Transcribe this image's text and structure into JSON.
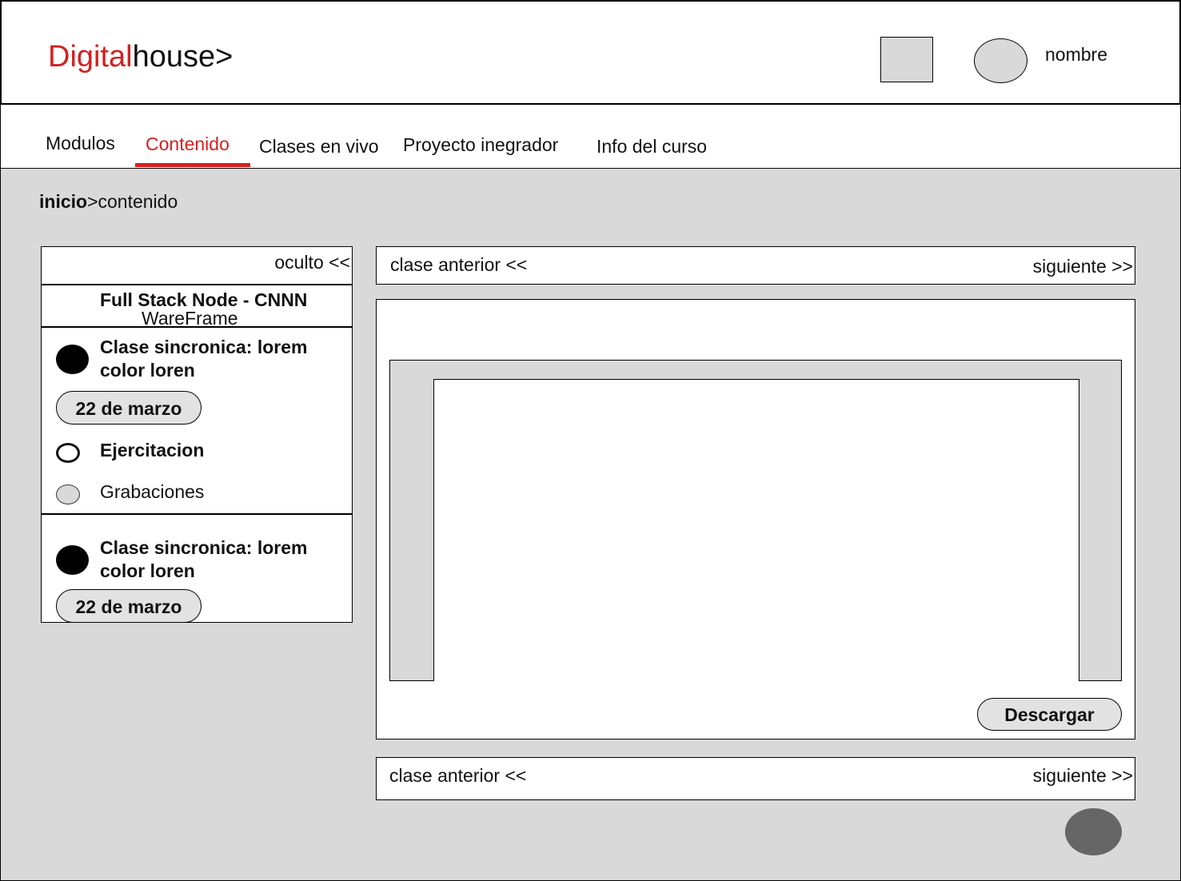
{
  "header": {
    "logo_part1": "Digital",
    "logo_part2": "house>",
    "user_name": "nombre"
  },
  "nav": {
    "tabs": [
      {
        "label": "Modulos"
      },
      {
        "label": "Contenido",
        "active": true
      },
      {
        "label": "Clases en vivo"
      },
      {
        "label": "Proyecto inegrador"
      },
      {
        "label": "Info del curso"
      }
    ]
  },
  "breadcrumb": {
    "root": "inicio",
    "separator": ">",
    "current": "contenido"
  },
  "sidebar": {
    "toggle_label": "oculto <<",
    "course_title": "Full Stack Node - CNNN",
    "course_subtitle": "WareFrame",
    "classes": [
      {
        "title_line1": "Clase sincronica: lorem",
        "title_line2": "color loren",
        "date": "22 de marzo",
        "items": [
          {
            "label": "Ejercitacion",
            "style": "ring"
          },
          {
            "label": "Grabaciones",
            "style": "grey"
          }
        ]
      },
      {
        "title_line1": "Clase sincronica: lorem",
        "title_line2": "color loren",
        "date": "22 de marzo"
      }
    ]
  },
  "pager_top": {
    "prev_label": "clase anterior <<",
    "next_label": "siguiente >>"
  },
  "viewer": {
    "download_label": "Descargar"
  },
  "pager_bottom": {
    "prev_label": "clase anterior <<",
    "next_label": "siguiente >>"
  },
  "colors": {
    "accent": "#d42020",
    "background": "#d9d9d9",
    "fab": "#666666"
  }
}
